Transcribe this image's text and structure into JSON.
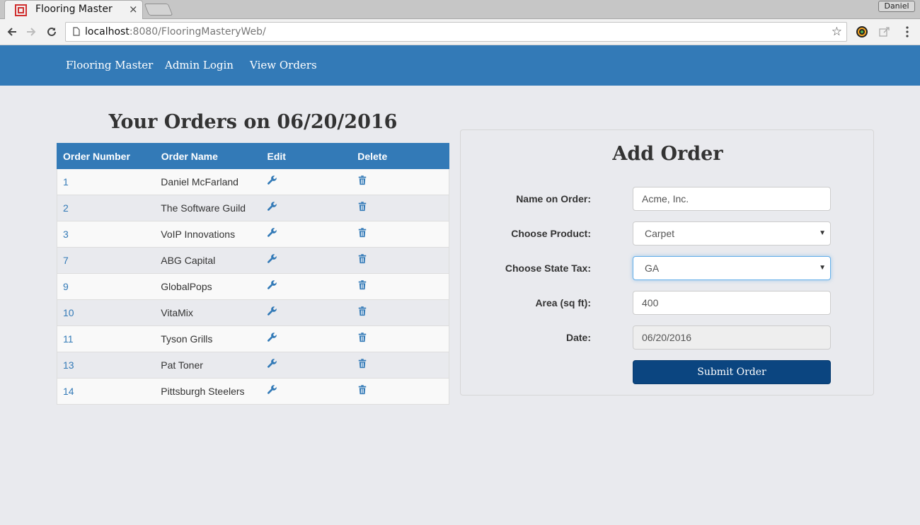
{
  "browser": {
    "tab_title": "Flooring Master",
    "tab_close": "×",
    "profile_name": "Daniel",
    "url_host": "localhost",
    "url_rest": ":8080/FlooringMasteryWeb/",
    "star": "☆"
  },
  "navbar": {
    "brand": "Flooring Master",
    "admin_login": "Admin Login",
    "view_orders": "View Orders"
  },
  "orders": {
    "title": "Your Orders on 06/20/2016",
    "headers": [
      "Order Number",
      "Order Name",
      "Edit",
      "Delete"
    ],
    "rows": [
      {
        "number": "1",
        "name": "Daniel McFarland"
      },
      {
        "number": "2",
        "name": "The Software Guild"
      },
      {
        "number": "3",
        "name": "VoIP Innovations"
      },
      {
        "number": "7",
        "name": "ABG Capital"
      },
      {
        "number": "9",
        "name": "GlobalPops"
      },
      {
        "number": "10",
        "name": "VitaMix"
      },
      {
        "number": "11",
        "name": "Tyson Grills"
      },
      {
        "number": "13",
        "name": "Pat Toner"
      },
      {
        "number": "14",
        "name": "Pittsburgh Steelers"
      }
    ],
    "edit_icon": "wrench-icon",
    "delete_icon": "trash-icon"
  },
  "add_order": {
    "title": "Add Order",
    "name_label": "Name on Order:",
    "name_value": "Acme, Inc.",
    "product_label": "Choose Product:",
    "product_value": "Carpet",
    "state_label": "Choose State Tax:",
    "state_value": "GA",
    "area_label": "Area (sq ft):",
    "area_value": "400",
    "date_label": "Date:",
    "date_value": "06/20/2016",
    "submit_label": "Submit Order"
  },
  "colors": {
    "navbar": "#337ab7",
    "submit": "#0b4580",
    "link": "#337ab7",
    "page_bg": "#e9eaee"
  }
}
